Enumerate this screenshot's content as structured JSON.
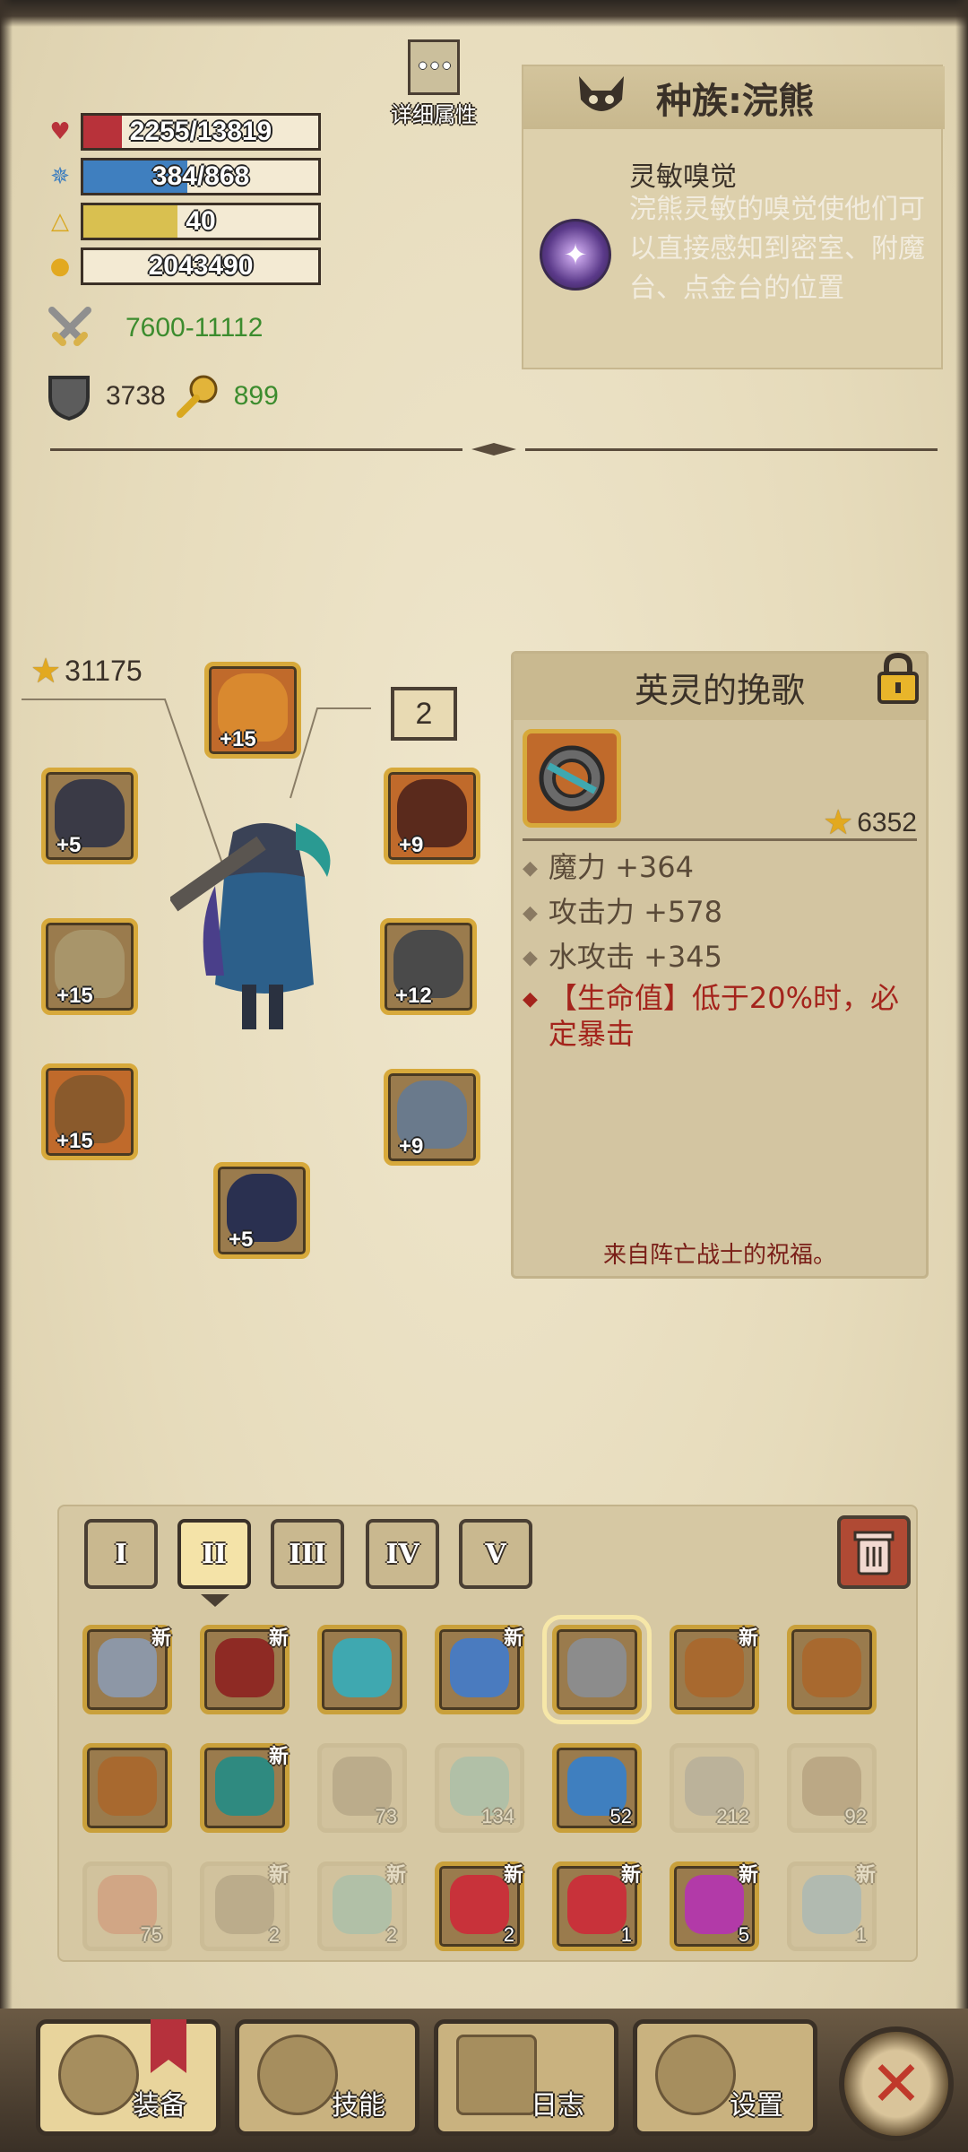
{
  "stats": {
    "hp": {
      "value": "2255/13819",
      "fill": 0.163,
      "color": "#b8323a",
      "icon": "heart-icon"
    },
    "mp": {
      "value": "384/868",
      "fill": 0.442,
      "color": "#3f7fbf",
      "icon": "mana-icon"
    },
    "level": {
      "value": "40",
      "fill": 0.4,
      "color": "#d9c050",
      "icon": "level-icon"
    },
    "gold": {
      "value": "2043490",
      "icon": "gold-icon"
    },
    "attack": "7600-11112",
    "defense": "3738",
    "luck": "899"
  },
  "detail_button": {
    "label": "详细属性",
    "icon": "ellipsis-icon"
  },
  "race": {
    "title": "种族:浣熊",
    "skill_name": "灵敏嗅觉",
    "skill_desc": "浣熊灵敏的嗅觉使他们可以直接感知到密室、附魔台、点金台的位置"
  },
  "equipment": {
    "total_power": "31175",
    "count_badge": "2",
    "slots": [
      {
        "name": "helmet",
        "plus": "+15"
      },
      {
        "name": "amulet",
        "plus": "+5"
      },
      {
        "name": "gloves",
        "plus": "+9"
      },
      {
        "name": "weapon",
        "plus": "+15"
      },
      {
        "name": "shoulder-armor",
        "plus": "+12"
      },
      {
        "name": "bracer",
        "plus": "+15"
      },
      {
        "name": "pants",
        "plus": "+9"
      },
      {
        "name": "boots",
        "plus": "+5"
      }
    ]
  },
  "item": {
    "title": "英灵的挽歌",
    "power": "6352",
    "attrs": [
      "魔力 +364",
      "攻击力 +578",
      "水攻击 +345"
    ],
    "special": "【生命值】低于20%时，必定暴击",
    "flavor": "来自阵亡战士的祝福。"
  },
  "inventory": {
    "tabs": [
      "I",
      "II",
      "III",
      "IV",
      "V"
    ],
    "active_tab": 1,
    "new_label": "新",
    "cells": [
      {
        "name": "gauntlet",
        "new": true,
        "num": "",
        "dim": false,
        "color": "#8d97a6"
      },
      {
        "name": "red-hood",
        "new": true,
        "num": "",
        "dim": false,
        "color": "#8e2a24"
      },
      {
        "name": "chest-plate",
        "new": false,
        "num": "",
        "dim": false,
        "color": "#3fa8b0"
      },
      {
        "name": "blue-boot",
        "new": true,
        "num": "",
        "dim": false,
        "color": "#4a7bbf"
      },
      {
        "name": "ring-selected",
        "new": false,
        "num": "",
        "dim": false,
        "color": "#8c8c8c"
      },
      {
        "name": "horn-bracer",
        "new": true,
        "num": "",
        "dim": false,
        "color": "#a8692f"
      },
      {
        "name": "horn-bracer-2",
        "new": false,
        "num": "",
        "dim": false,
        "color": "#a8692f"
      },
      {
        "name": "horn-bracer-3",
        "new": false,
        "num": "",
        "dim": false,
        "color": "#a8692f"
      },
      {
        "name": "gem-ring",
        "new": true,
        "num": "",
        "dim": false,
        "color": "#2f8a80"
      },
      {
        "name": "pickaxe",
        "new": false,
        "num": "73",
        "dim": true,
        "color": "#8a7a60"
      },
      {
        "name": "teal-emblem",
        "new": false,
        "num": "134",
        "dim": true,
        "color": "#6fb3b0"
      },
      {
        "name": "blue-potion",
        "new": false,
        "num": "52",
        "dim": false,
        "color": "#3f7fbf"
      },
      {
        "name": "stone-block",
        "new": false,
        "num": "212",
        "dim": true,
        "color": "#8a8a8a"
      },
      {
        "name": "ore-cart",
        "new": false,
        "num": "92",
        "dim": true,
        "color": "#8a6f50"
      },
      {
        "name": "red-fish",
        "new": false,
        "num": "75",
        "dim": true,
        "color": "#c86a50"
      },
      {
        "name": "pickaxe-2",
        "new": true,
        "num": "2",
        "dim": true,
        "color": "#8a7a60"
      },
      {
        "name": "teal-emblem-2",
        "new": true,
        "num": "2",
        "dim": true,
        "color": "#6fb3b0"
      },
      {
        "name": "red-potion",
        "new": true,
        "num": "2",
        "dim": false,
        "color": "#c8323a"
      },
      {
        "name": "red-gem",
        "new": true,
        "num": "1",
        "dim": false,
        "color": "#c8323a"
      },
      {
        "name": "purple-potion",
        "new": true,
        "num": "5",
        "dim": false,
        "color": "#b23aa8"
      },
      {
        "name": "blue-hook",
        "new": true,
        "num": "1",
        "dim": true,
        "color": "#6fa3c8"
      }
    ]
  },
  "nav": [
    "装备",
    "技能",
    "日志",
    "设置"
  ]
}
